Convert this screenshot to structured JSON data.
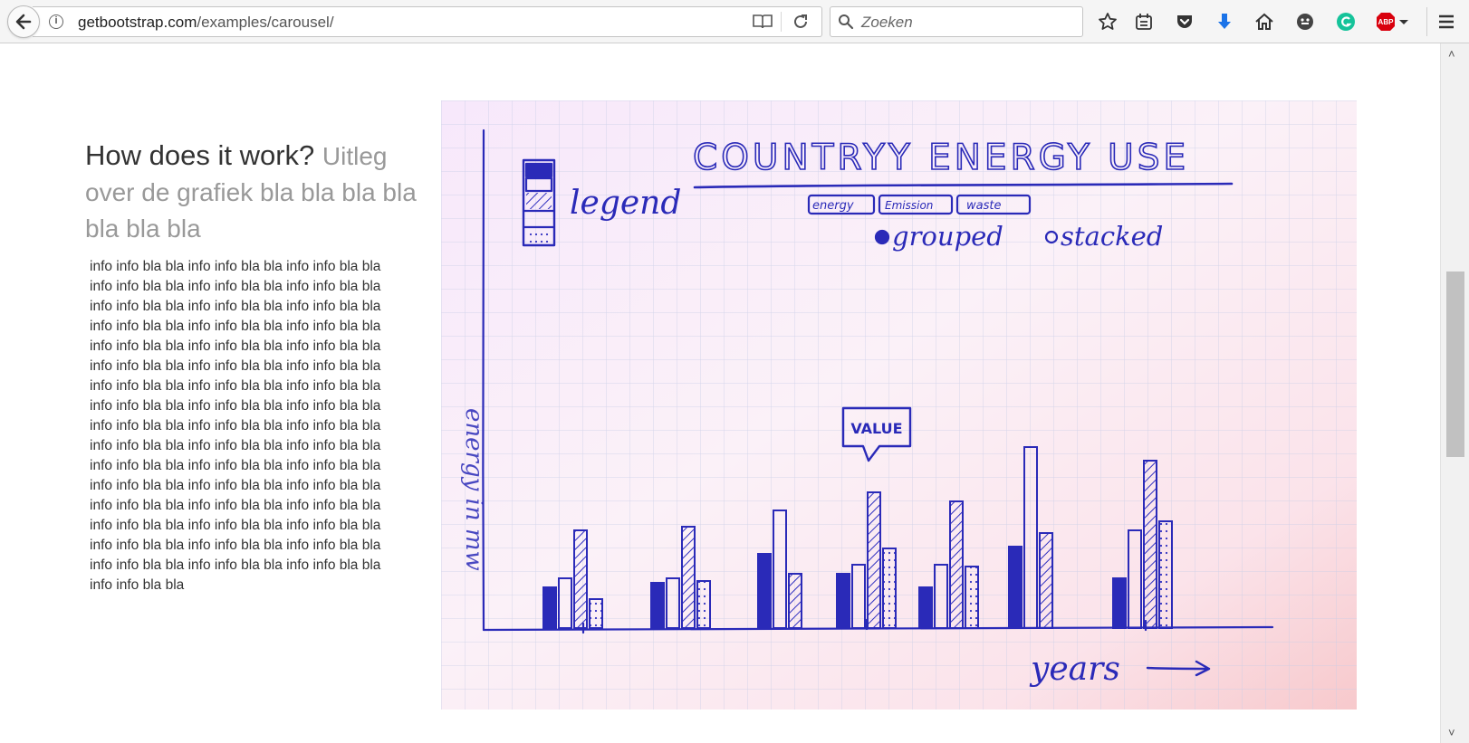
{
  "browser": {
    "url_domain": "getbootstrap.com",
    "url_path": "/examples/carousel/",
    "search_placeholder": "Zoeken",
    "toolbar_icons": [
      "bookmark-star-icon",
      "reading-list-icon",
      "pocket-icon",
      "downloads-icon",
      "home-icon",
      "sync-face-icon",
      "grammarly-icon",
      "adblock-icon",
      "menu-icon"
    ],
    "adblock_label": "ABP"
  },
  "content": {
    "heading_main": "How does it work?",
    "heading_muted": "Uitleg over de grafiek bla bla bla bla bla bla bla",
    "lead": "info info bla bla info info bla bla info info bla bla info info bla bla info info bla bla info info bla bla info info bla bla info info bla bla info info bla bla info info bla bla info info bla bla info info bla bla info info bla bla info info bla bla info info bla bla info info bla bla info info bla bla info info bla bla info info bla bla info info bla bla info info bla bla info info bla bla info info bla bla info info bla bla info info bla bla info info bla bla info info bla bla info info bla bla info info bla bla info info bla bla info info bla bla info info bla bla info info bla bla info info bla bla info info bla bla info info bla bla info info bla bla info info bla bla info info bla bla info info bla bla info info bla bla info info bla bla info info bla bla info info bla bla info info bla bla info info bla bla info info bla bla info info bla bla info info bla bla"
  },
  "sketch": {
    "title": "COUNTRYY ENERGY USE",
    "legend_label": "legend",
    "filter_chips": [
      "energy",
      "Emission",
      "waste"
    ],
    "radio_grouped": "grouped",
    "radio_stacked": "stacked",
    "tooltip": "VALUE",
    "x_axis_label": "years",
    "y_axis_label": "energy in mw"
  },
  "colors": {
    "ink": "#2a2ab8",
    "paper": "#fbeaf6",
    "grid": "#c7cde6",
    "accent_blue": "#1a73e8",
    "grammarly_green": "#15c39a",
    "abp_red": "#d9000d"
  }
}
